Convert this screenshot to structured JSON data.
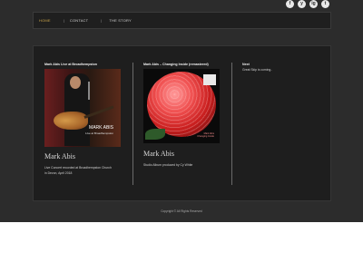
{
  "social": [
    "f",
    "y",
    "ig",
    "t"
  ],
  "social_icons": [
    "facebook-icon",
    "youtube-icon",
    "instagram-icon",
    "twitter-icon"
  ],
  "nav": {
    "items": [
      "HOME",
      "CONTACT",
      "THE STORY"
    ],
    "separator": "|",
    "active_color": "#c9a34a"
  },
  "columns": [
    {
      "title": "Mark Abis Live at Broadhempston",
      "image_caption": "MARK ABIS",
      "image_subcaption": "Live at Broadhempston",
      "artist": "Mark Abis",
      "desc_line1": "Live Concert recorded at Broadhempston Church",
      "desc_line2": "in Devon, April 2018"
    },
    {
      "title": "Mark Abis – Changing Inside (remastered)",
      "image_caption": "Mark Abis\nChanging Inside",
      "artist": "Mark Abis",
      "desc_line1": "Studio Album produced by Cy White",
      "desc_line2": ""
    },
    {
      "title": "Next",
      "desc_line1": "Great Skip is coming..",
      "desc_line2": ""
    }
  ],
  "footer": "Copyright © All Rights Reserved"
}
